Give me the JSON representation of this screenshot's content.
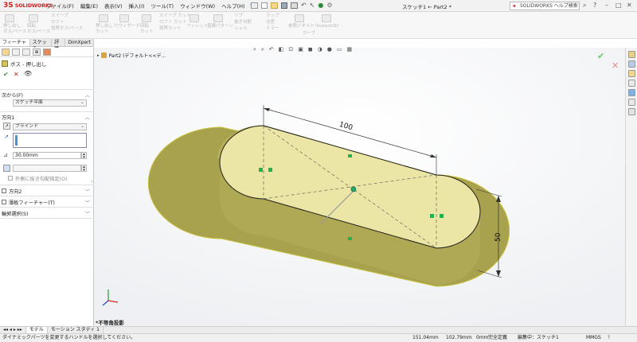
{
  "app": {
    "logo_ds": "3S",
    "brand": "SOLIDWORKS",
    "doc_title": "スケッチ1 ← Part2 *"
  },
  "menus": [
    "ファイル(F)",
    "編集(E)",
    "表示(V)",
    "挿入(I)",
    "ツール(T)",
    "ウィンドウ(W)",
    "ヘルプ(H)"
  ],
  "search": {
    "placeholder": "SOLIDWORKS ヘルプ検索"
  },
  "ribbon": {
    "extrude_boss": "押し出し\nボス/ベース",
    "revolve_boss": "回転\nボス/ベース",
    "sweep": "スイープ",
    "loft": "ロフト",
    "boundary_boss": "境界ボス/ベース",
    "extrude_cut": "押し出し\nカット",
    "hole_wizard": "穴ウィザード",
    "revolve_cut": "回転\nカット",
    "sweep_cut": "スイープ カット",
    "loft_cut": "ロフト カット",
    "boundary_cut": "境界カット",
    "fillet": "フィレット",
    "linear_pattern": "直線パターン",
    "rib": "リブ",
    "draft": "抜き勾配",
    "shell": "シェル",
    "wrap": "ラップ",
    "intersect": "交差",
    "mirror": "ミラー",
    "ref_geometry": "参照ジオメトリ",
    "curves": "カーブ",
    "instant3d": "Instant3D"
  },
  "manager_tabs": [
    "フィーチャー",
    "スケッチ",
    "評価",
    "DimXpert"
  ],
  "property_manager": {
    "title": "ボス - 押し出し",
    "from_label": "次から(F)",
    "from_value": "スケッチ平面",
    "direction1_label": "方向1",
    "end_condition": "ブラインド",
    "depth": "30.00mm",
    "draft_outward": "外側に抜き勾配指定(O)",
    "direction2_label": "方向2",
    "thin_feature": "薄板フィーチャー(T)",
    "contour_select": "輪郭選択(S)"
  },
  "viewport": {
    "breadcrumb": "Part2 (デフォルト<<デ...",
    "dim_length": "100",
    "dim_width": "50",
    "view_label": "*不等角投影"
  },
  "bottom_tabs": [
    "モデル",
    "モーション スタディ 1"
  ],
  "status": {
    "hint": "ダイナミックパーツを変更するハンドルを選択してください。",
    "x": "151.04mm",
    "y": "102.79mm",
    "z": "0mm",
    "state": "完全定義",
    "editing": "編集中：スケッチ1",
    "units": "MMGS"
  },
  "colors": {
    "accent": "#d21f1f",
    "model_fill": "#e3dc8e",
    "model_side": "#a8a14e",
    "selection_green": "#22b14c"
  },
  "icons": [
    "solidworks-logo",
    "pin-icon",
    "search-icon",
    "help-icon",
    "minimize-icon",
    "maximize-icon",
    "close-icon",
    "confirm-check-icon",
    "cancel-x-icon",
    "preview-eye-icon",
    "triad-icon"
  ]
}
